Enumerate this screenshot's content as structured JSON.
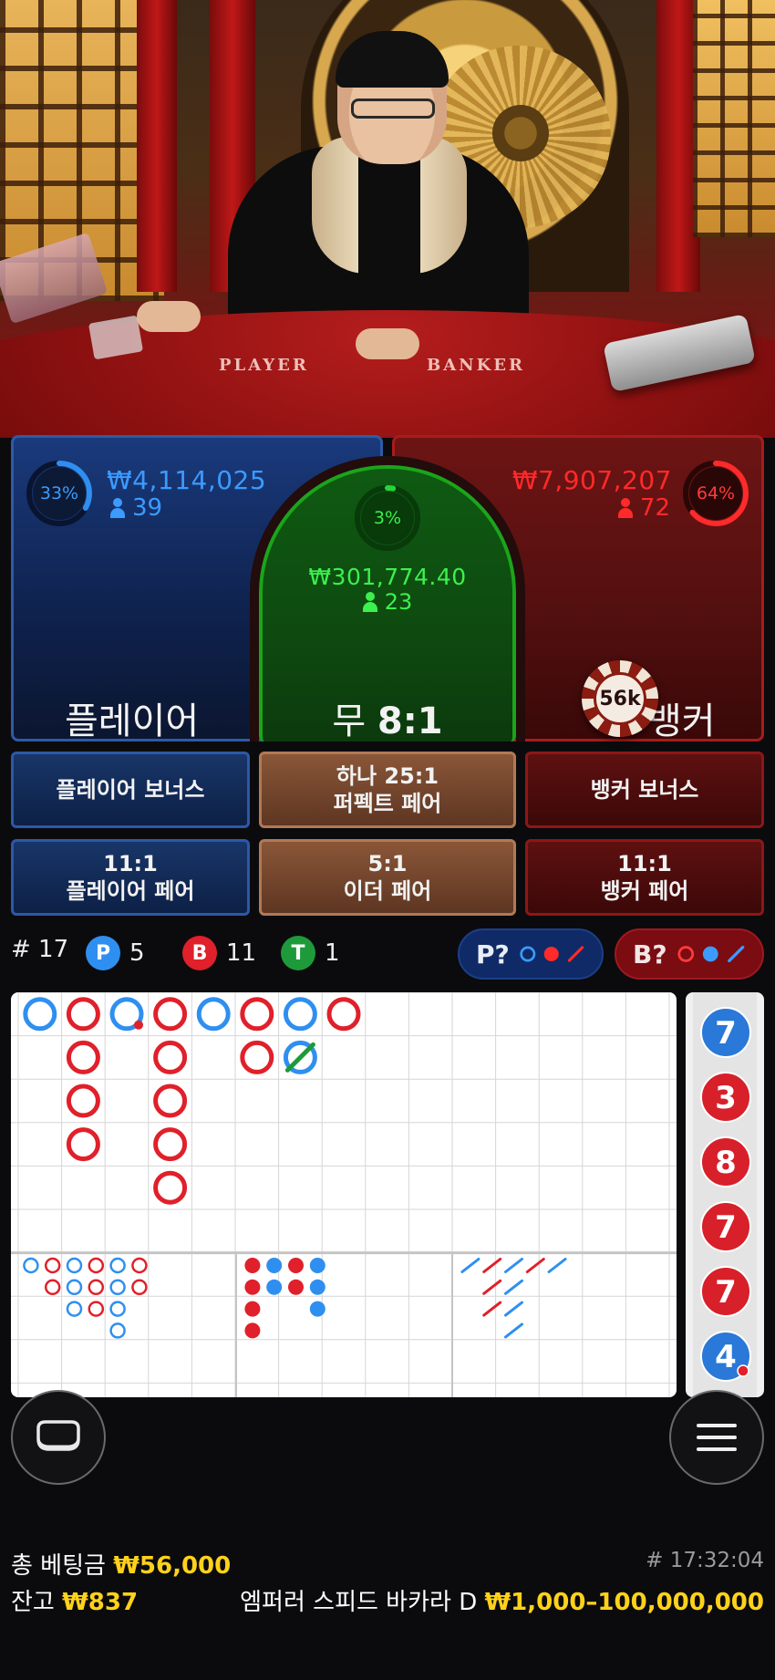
{
  "video": {
    "table_player_label": "PLAYER",
    "table_banker_label": "BANKER"
  },
  "player": {
    "percent": "33%",
    "amount": "₩4,114,025",
    "bettors": "39",
    "label": "플레이어",
    "percent_value": 0.33,
    "color": "#2f8ff0"
  },
  "tie": {
    "percent": "3%",
    "amount": "₩301,774.40",
    "bettors": "23",
    "label_prefix": "무",
    "payout": "8:1",
    "percent_value": 0.03,
    "color": "#27d43a"
  },
  "banker": {
    "percent": "64%",
    "amount": "₩7,907,207",
    "bettors": "72",
    "label": "뱅커",
    "percent_value": 0.64,
    "color": "#ff2a2a",
    "chip_value": "56k"
  },
  "side_bets": {
    "player_bonus": "플레이어 보너스",
    "perfect_pair_line1": "하나 25:1",
    "perfect_pair_line2": "퍼펙트 페어",
    "banker_bonus": "뱅커 보너스",
    "player_pair_line1": "11:1",
    "player_pair_line2": "플레이어 페어",
    "either_pair_line1": "5:1",
    "either_pair_line2": "이더 페어",
    "banker_pair_line1": "11:1",
    "banker_pair_line2": "뱅커 페어"
  },
  "stats": {
    "round_label": "# 17",
    "player_letter": "P",
    "player_count": "5",
    "banker_letter": "B",
    "banker_count": "11",
    "tie_letter": "T",
    "tie_count": "1",
    "player_predict": "P?",
    "banker_predict": "B?"
  },
  "big_road": [
    {
      "col": 0,
      "row": 0,
      "side": "P"
    },
    {
      "col": 1,
      "row": 0,
      "side": "B"
    },
    {
      "col": 1,
      "row": 1,
      "side": "B"
    },
    {
      "col": 1,
      "row": 2,
      "side": "B"
    },
    {
      "col": 1,
      "row": 3,
      "side": "B"
    },
    {
      "col": 2,
      "row": 0,
      "side": "P",
      "banker_pair": true
    },
    {
      "col": 3,
      "row": 0,
      "side": "B"
    },
    {
      "col": 3,
      "row": 1,
      "side": "B"
    },
    {
      "col": 3,
      "row": 2,
      "side": "B"
    },
    {
      "col": 3,
      "row": 3,
      "side": "B"
    },
    {
      "col": 3,
      "row": 4,
      "side": "B"
    },
    {
      "col": 4,
      "row": 0,
      "side": "P"
    },
    {
      "col": 5,
      "row": 0,
      "side": "B"
    },
    {
      "col": 5,
      "row": 1,
      "side": "B"
    },
    {
      "col": 6,
      "row": 0,
      "side": "P"
    },
    {
      "col": 6,
      "row": 1,
      "side": "P",
      "tie": true
    },
    {
      "col": 7,
      "row": 0,
      "side": "B"
    }
  ],
  "big_eye_road": [
    {
      "c": 0,
      "r": 0,
      "k": "blue"
    },
    {
      "c": 1,
      "r": 0,
      "k": "red"
    },
    {
      "c": 2,
      "r": 0,
      "k": "blue"
    },
    {
      "c": 3,
      "r": 0,
      "k": "red"
    },
    {
      "c": 4,
      "r": 0,
      "k": "blue"
    },
    {
      "c": 5,
      "r": 0,
      "k": "red"
    },
    {
      "c": 1,
      "r": 1,
      "k": "red"
    },
    {
      "c": 2,
      "r": 1,
      "k": "blue"
    },
    {
      "c": 3,
      "r": 1,
      "k": "red"
    },
    {
      "c": 4,
      "r": 1,
      "k": "blue"
    },
    {
      "c": 5,
      "r": 1,
      "k": "red"
    },
    {
      "c": 2,
      "r": 2,
      "k": "blue"
    },
    {
      "c": 3,
      "r": 2,
      "k": "red"
    },
    {
      "c": 4,
      "r": 2,
      "k": "blue"
    },
    {
      "c": 4,
      "r": 3,
      "k": "blue"
    }
  ],
  "small_road": [
    {
      "c": 0,
      "r": 0,
      "k": "red"
    },
    {
      "c": 1,
      "r": 0,
      "k": "blue"
    },
    {
      "c": 2,
      "r": 0,
      "k": "red"
    },
    {
      "c": 3,
      "r": 0,
      "k": "blue"
    },
    {
      "c": 0,
      "r": 1,
      "k": "red"
    },
    {
      "c": 1,
      "r": 1,
      "k": "blue"
    },
    {
      "c": 2,
      "r": 1,
      "k": "red"
    },
    {
      "c": 3,
      "r": 1,
      "k": "blue"
    },
    {
      "c": 0,
      "r": 2,
      "k": "red"
    },
    {
      "c": 3,
      "r": 2,
      "k": "blue"
    },
    {
      "c": 0,
      "r": 3,
      "k": "red"
    }
  ],
  "cockroach_road": [
    {
      "c": 0,
      "r": 0,
      "k": "blue"
    },
    {
      "c": 1,
      "r": 0,
      "k": "red"
    },
    {
      "c": 2,
      "r": 0,
      "k": "blue"
    },
    {
      "c": 3,
      "r": 0,
      "k": "red"
    },
    {
      "c": 4,
      "r": 0,
      "k": "blue"
    },
    {
      "c": 1,
      "r": 1,
      "k": "red"
    },
    {
      "c": 2,
      "r": 1,
      "k": "blue"
    },
    {
      "c": 1,
      "r": 2,
      "k": "red"
    },
    {
      "c": 2,
      "r": 2,
      "k": "blue"
    },
    {
      "c": 2,
      "r": 3,
      "k": "blue"
    }
  ],
  "bead_strip": [
    {
      "value": "7",
      "side": "P"
    },
    {
      "value": "3",
      "side": "B"
    },
    {
      "value": "8",
      "side": "B"
    },
    {
      "value": "7",
      "side": "B"
    },
    {
      "value": "7",
      "side": "B"
    },
    {
      "value": "4",
      "side": "P",
      "banker_pair": true
    }
  ],
  "footer": {
    "total_bet_label": "총 베팅금",
    "total_bet_value": "₩56,000",
    "balance_label": "잔고",
    "balance_value": "₩837",
    "round_id": "# 17:32:04",
    "table_name": "엠퍼러 스피드 바카라 D",
    "limits": "₩1,000–100,000,000"
  },
  "colors": {
    "player_blue": "#2f8ff0",
    "banker_red": "#e0202a",
    "tie_green": "#27d43a",
    "gold": "#ffd21a"
  }
}
